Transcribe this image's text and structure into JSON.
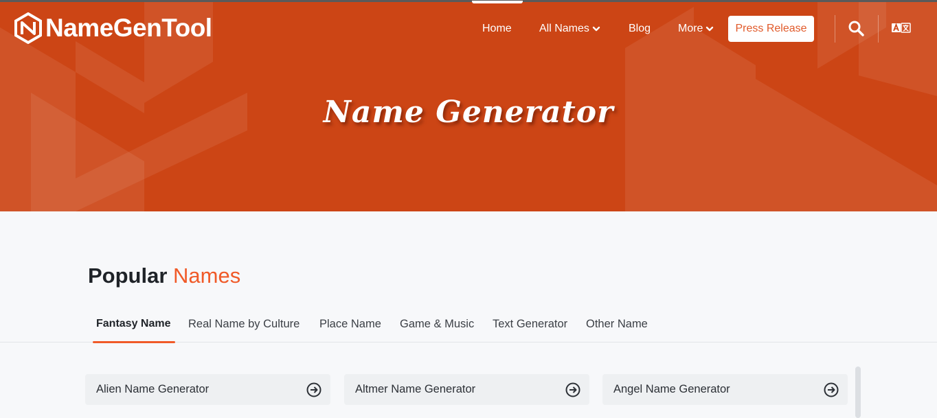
{
  "brand": {
    "name": "NameGenTool",
    "accent_color": "#cc4515",
    "highlight_color": "#f05a28"
  },
  "nav": {
    "home": "Home",
    "all_names": "All Names",
    "blog": "Blog",
    "more": "More",
    "press_release": "Press Release",
    "search_icon": "search-icon",
    "language_icon": "translate-icon"
  },
  "hero": {
    "title": "Name Generator"
  },
  "section": {
    "title_main": "Popular",
    "title_accent": "Names"
  },
  "tabs": [
    {
      "label": "Fantasy Name",
      "active": true
    },
    {
      "label": "Real Name by Culture",
      "active": false
    },
    {
      "label": "Place Name",
      "active": false
    },
    {
      "label": "Game & Music",
      "active": false
    },
    {
      "label": "Text Generator",
      "active": false
    },
    {
      "label": "Other Name",
      "active": false
    }
  ],
  "cards": [
    {
      "label": "Alien Name Generator",
      "icon": "arrow-right-circle-icon"
    },
    {
      "label": "Altmer Name Generator",
      "icon": "arrow-right-circle-icon"
    },
    {
      "label": "Angel Name Generator",
      "icon": "arrow-right-circle-icon"
    }
  ]
}
